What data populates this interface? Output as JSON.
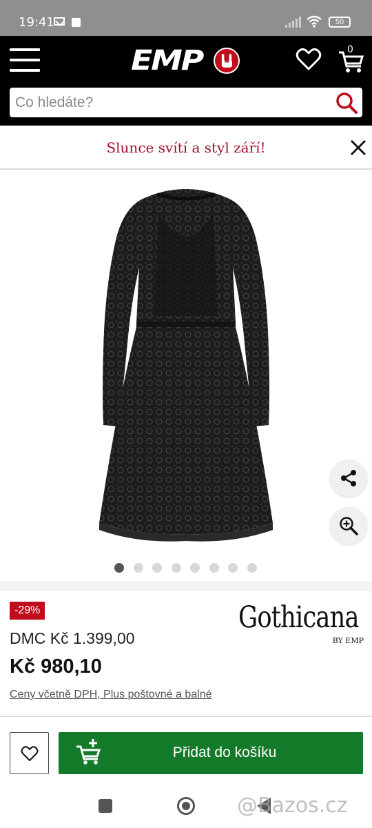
{
  "status_bar": {
    "time": "19:41",
    "battery": "50"
  },
  "header": {
    "logo_text": "EMP",
    "cart_count": "0",
    "search_placeholder": "Co hledáte?"
  },
  "promo": {
    "text": "Slunce svítí a styl září!"
  },
  "gallery": {
    "image_count": 8,
    "active_index": 0
  },
  "product": {
    "discount_badge": "-29%",
    "original_price": "DMC Kč 1.399,00",
    "price": "Kč 980,10",
    "price_note": "Ceny včetně DPH, Plus poštovné a balné",
    "brand_name": "Gothicana",
    "brand_by": "BY EMP"
  },
  "actions": {
    "add_to_cart_label": "Přidat do košíku"
  },
  "watermark": "@Bazos.cz",
  "colors": {
    "header_bg": "#000000",
    "accent_red": "#c00d1e",
    "cart_button_green": "#137a2a",
    "promo_text": "#a0102a"
  }
}
